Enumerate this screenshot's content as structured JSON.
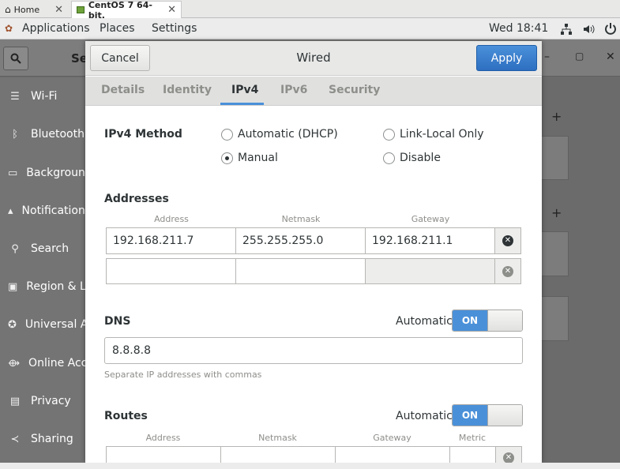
{
  "vm_tabs": [
    {
      "label": "Home",
      "close": "✕"
    },
    {
      "label": "CentOS 7 64-bit.",
      "close": "✕"
    }
  ],
  "topbar": {
    "applications": "Applications",
    "places": "Places",
    "settings": "Settings",
    "clock": "Wed 18:41"
  },
  "settings_window": {
    "title_fragment": "Se",
    "sidebar": [
      "Wi-Fi",
      "Bluetooth",
      "Background",
      "Notifications",
      "Search",
      "Region & Language",
      "Universal Access",
      "Online Accounts",
      "Privacy",
      "Sharing"
    ],
    "window_controls": {
      "minimize": "–",
      "maximize": "▢",
      "close": "✕"
    },
    "add_symbol": "+"
  },
  "dialog": {
    "title": "Wired",
    "cancel": "Cancel",
    "apply": "Apply",
    "tabs": [
      "Details",
      "Identity",
      "IPv4",
      "IPv6",
      "Security"
    ],
    "active_tab": "IPv4",
    "ipv4_method_label": "IPv4 Method",
    "methods": [
      {
        "label": "Automatic (DHCP)",
        "selected": false
      },
      {
        "label": "Link-Local Only",
        "selected": false
      },
      {
        "label": "Manual",
        "selected": true
      },
      {
        "label": "Disable",
        "selected": false
      }
    ],
    "addresses": {
      "label": "Addresses",
      "headers": [
        "Address",
        "Netmask",
        "Gateway"
      ],
      "rows": [
        [
          "192.168.211.7",
          "255.255.255.0",
          "192.168.211.1"
        ],
        [
          "",
          "",
          ""
        ]
      ]
    },
    "dns": {
      "label": "DNS",
      "automatic_label": "Automatic",
      "switch": "ON",
      "value": "8.8.8.8",
      "hint": "Separate IP addresses with commas"
    },
    "routes": {
      "label": "Routes",
      "automatic_label": "Automatic",
      "switch": "ON",
      "headers": [
        "Address",
        "Netmask",
        "Gateway",
        "Metric"
      ]
    },
    "colors": {
      "accent": "#4a90d9",
      "remove_active": "#2e3436",
      "remove_inactive": "#8d8f8a"
    }
  }
}
